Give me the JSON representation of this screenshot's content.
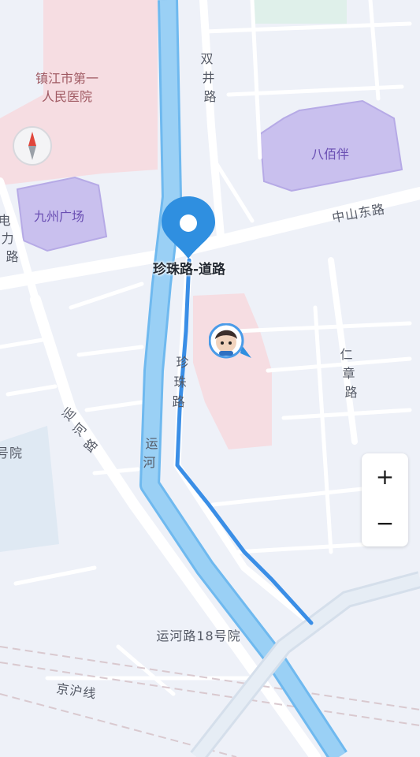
{
  "map": {
    "labels": {
      "hospital": [
        "镇江市第一",
        "人民医院"
      ],
      "jiuzhou_plaza": "九州广场",
      "babaiban": "八佰伴",
      "shuangjing_road": [
        "双",
        "井",
        "路"
      ],
      "zhongshan_east_road": "中山东路",
      "dianli_road": [
        "电",
        "力",
        "路"
      ],
      "zhenzhu_road": [
        "珍",
        "珠",
        "路"
      ],
      "renzhang_road": [
        "仁",
        "章",
        "路"
      ],
      "yunhe_road": [
        "运",
        "河",
        "路"
      ],
      "yunhe_canal": [
        "运",
        "河"
      ],
      "yunhe_road_18": "运河路18号院",
      "jinghu_line": "京沪线",
      "hospital_partial": "号院"
    },
    "colors": {
      "background": "#eef1f8",
      "road": "#ffffff",
      "water": "#9ad0f5",
      "water_edge": "#6fb9ef",
      "hospital_area": "#f5dbe0",
      "mall_area": "#c9c0ee",
      "route": "#3a8ee6",
      "pin": "#2f8fe0"
    }
  },
  "pin": {
    "label": "珍珠路-道路"
  },
  "controls": {
    "zoom_in": "+",
    "zoom_out": "−"
  }
}
